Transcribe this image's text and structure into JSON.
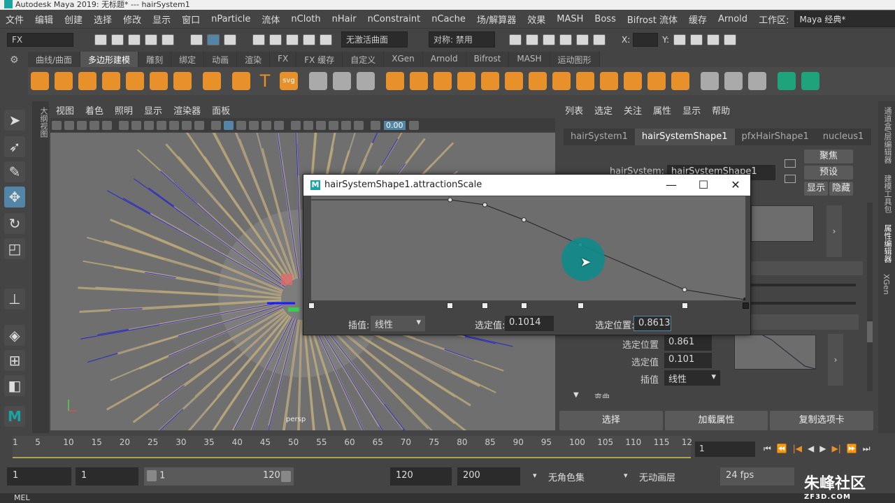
{
  "app": {
    "title": "Autodesk Maya 2019: 无标题*   ---   hairSystem1"
  },
  "menubar": {
    "items": [
      "文件",
      "编辑",
      "创建",
      "选择",
      "修改",
      "显示",
      "窗口",
      "nParticle",
      "流体",
      "nCloth",
      "nHair",
      "nConstraint",
      "nCache",
      "场/解算器",
      "效果",
      "MASH",
      "Boss",
      "Bifrost 流体",
      "缓存",
      "Arnold"
    ],
    "workspace_label": "工作区:",
    "workspace_value": "Maya 经典*"
  },
  "statusline": {
    "mode": "FX",
    "live_surface": "无激活曲面",
    "symmetry": "对称: 禁用",
    "x_label": "X:",
    "y_label": "Y:"
  },
  "shelf": {
    "tabs": [
      "曲线/曲面",
      "多边形建模",
      "雕刻",
      "绑定",
      "动画",
      "渲染",
      "FX",
      "FX 缓存",
      "自定义",
      "XGen",
      "Arnold",
      "Bifrost",
      "MASH",
      "运动图形"
    ],
    "active_tab": "多边形建模",
    "icons": [
      "sphere-icon",
      "cube-icon",
      "cylinder-icon",
      "cone-icon",
      "torus-icon",
      "plane-icon",
      "disc-icon",
      "platonic-icon",
      "star-icon",
      "type-icon",
      "svg-icon",
      "sweep-icon",
      "super-shape-icon",
      "snowflake-icon",
      "combine-icon",
      "separate-icon",
      "extract-icon",
      "booleans-icon",
      "smooth-icon",
      "reduce-icon",
      "mirror-icon",
      "bridge-icon",
      "bevel-icon",
      "extrude-icon",
      "fill-hole-icon",
      "collapse-icon",
      "target-weld-icon",
      "multi-cut-icon",
      "quad-draw-icon",
      "sculpt-icon",
      "uv-icon",
      "unfold-icon"
    ],
    "svg_label": "svg",
    "type_label": "T"
  },
  "viewport": {
    "panel_label": "大纲视图",
    "menu": [
      "视图",
      "着色",
      "照明",
      "显示",
      "渲染器",
      "面板"
    ],
    "exposure": "0.00",
    "camera_label": "persp"
  },
  "attribute_editor": {
    "menu": [
      "列表",
      "选定",
      "关注",
      "属性",
      "显示",
      "帮助"
    ],
    "tabs": [
      "hairSystem1",
      "hairSystemShape1",
      "pfxHairShape1",
      "nucleus1"
    ],
    "active_tab": "hairSystemShape1",
    "node_label": "hairSystem:",
    "node_value": "hairSystemShape1",
    "focus_button": "聚焦",
    "presets_button": "预设",
    "show_button": "显示",
    "hide_button": "隐藏",
    "selected_position_label": "选定位置",
    "selected_position_value": "0.861",
    "selected_value_label": "选定值",
    "selected_value_value": "0.101",
    "interpolation_label": "插值",
    "interpolation_value": "线性",
    "section_label": "变曲",
    "bottom_buttons": [
      "选择",
      "加载属性",
      "复制选项卡"
    ],
    "side_tabs": [
      "通道盒/层编辑器",
      "建模工具包",
      "属性编辑器",
      "XGen"
    ]
  },
  "ramp_dialog": {
    "title": "hairSystemShape1.attractionScale",
    "interpolation_label": "插值:",
    "interpolation_value": "线性",
    "selected_value_label": "选定值:",
    "selected_value": "0.1014",
    "selected_position_label": "选定位置:",
    "selected_position": "0.8613",
    "curve_points": [
      {
        "position": 0.32,
        "value": 1.0
      },
      {
        "position": 0.4,
        "value": 0.95
      },
      {
        "position": 0.49,
        "value": 0.8
      },
      {
        "position": 0.62,
        "value": 0.55
      },
      {
        "position": 0.86,
        "value": 0.1
      },
      {
        "position": 1.0,
        "value": 0.0
      }
    ],
    "selected_index": 5
  },
  "timeline": {
    "ticks": [
      "1",
      "5",
      "10",
      "15",
      "20",
      "25",
      "30",
      "35",
      "40",
      "45",
      "50",
      "55",
      "60",
      "65",
      "70",
      "75",
      "80",
      "85",
      "90",
      "95",
      "100",
      "105",
      "110",
      "115",
      "12"
    ],
    "current_frame": "1"
  },
  "range_bar": {
    "start": "1",
    "playback_start": "1",
    "slider_start": "1",
    "slider_end": "120",
    "playback_end": "120",
    "end": "200",
    "character_set": "无角色集",
    "anim_layer": "无动画层",
    "fps": "24 fps"
  },
  "command_line": {
    "label": "MEL"
  },
  "watermark": {
    "text": "朱峰社区",
    "sub": "ZF3D.COM"
  }
}
